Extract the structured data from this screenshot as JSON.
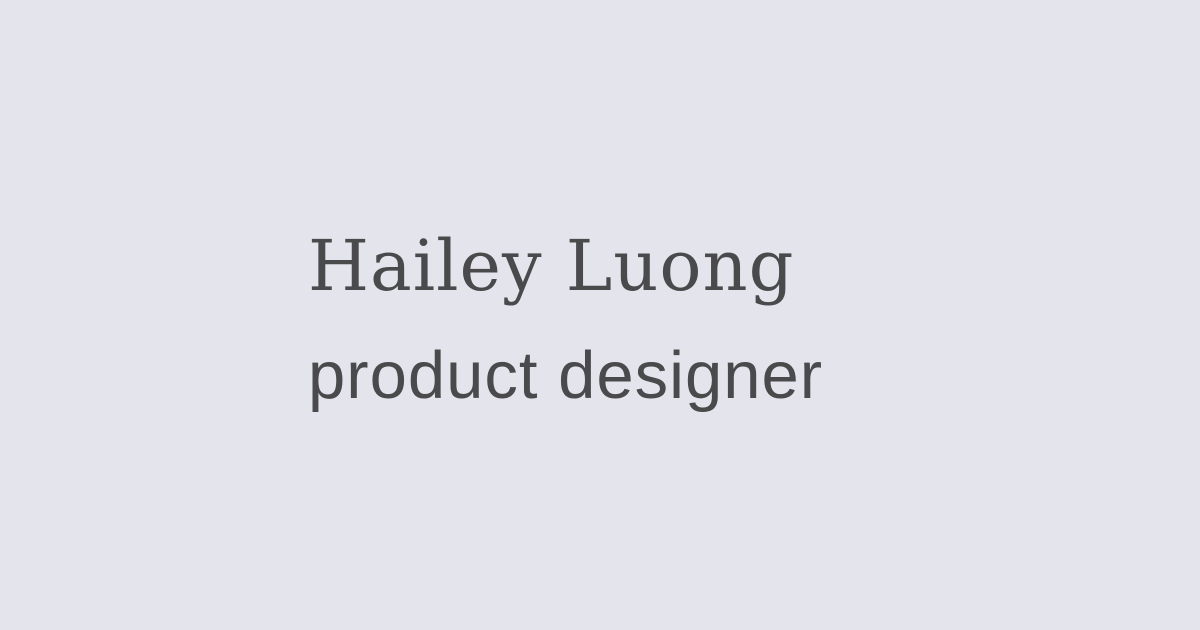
{
  "card": {
    "name": "Hailey Luong",
    "role": "product designer"
  },
  "colors": {
    "background": "#e4e4ec",
    "text": "#4a4a4d"
  }
}
